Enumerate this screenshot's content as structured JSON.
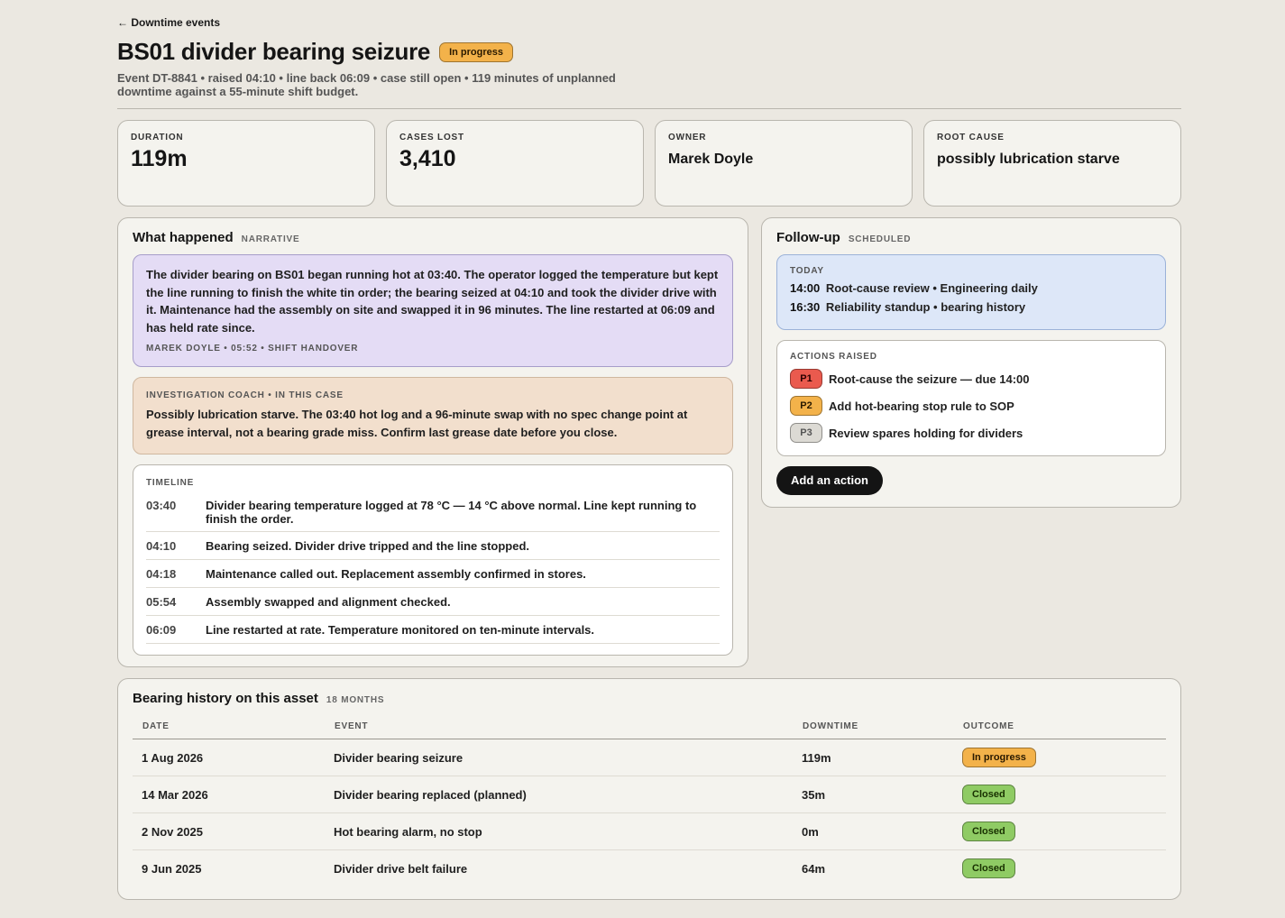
{
  "nav": {
    "back_label": "← Downtime events"
  },
  "header": {
    "title": "BS01 divider bearing seizure",
    "status": "In progress",
    "subtitle": "Event DT-8841 • raised 04:10 • line back 06:09 • case still open • 119 minutes of unplanned downtime against a 55-minute shift budget."
  },
  "stats": [
    {
      "label": "DURATION",
      "value": "119m"
    },
    {
      "label": "CASES LOST",
      "value": "3,410"
    },
    {
      "label": "OWNER",
      "value": "Marek Doyle"
    },
    {
      "label": "ROOT CAUSE",
      "value": "possibly lubrication starve"
    }
  ],
  "what_happened": {
    "title": "What happened",
    "tag": "NARRATIVE",
    "narrative": "The divider bearing on BS01 began running hot at 03:40. The operator logged the temperature but kept the line running to finish the white tin order; the bearing seized at 04:10 and took the divider drive with it. Maintenance had the assembly on site and swapped it in 96 minutes. The line restarted at 06:09 and has held rate since.",
    "narrative_author": "MAREK DOYLE • 05:52 • SHIFT HANDOVER",
    "coach_label": "INVESTIGATION COACH • IN THIS CASE",
    "coach_text": "Possibly lubrication starve. The 03:40 hot log and a 96-minute swap with no spec change point at grease interval, not a bearing grade miss. Confirm last grease date before you close.",
    "timeline_label": "TIMELINE",
    "timeline": [
      {
        "time": "03:40",
        "text": "Divider bearing temperature logged at 78 °C — 14 °C above normal. Line kept running to finish the order."
      },
      {
        "time": "04:10",
        "text": "Bearing seized. Divider drive tripped and the line stopped."
      },
      {
        "time": "04:18",
        "text": "Maintenance called out. Replacement assembly confirmed in stores."
      },
      {
        "time": "05:54",
        "text": "Assembly swapped and alignment checked."
      },
      {
        "time": "06:09",
        "text": "Line restarted at rate. Temperature monitored on ten-minute intervals."
      }
    ]
  },
  "followup": {
    "title": "Follow-up",
    "tag": "SCHEDULED",
    "today_label": "TODAY",
    "today": [
      {
        "time": "14:00",
        "text": "Root-cause review • Engineering daily"
      },
      {
        "time": "16:30",
        "text": "Reliability standup • bearing history"
      }
    ],
    "actions_label": "ACTIONS RAISED",
    "actions": [
      {
        "priority": "P1",
        "text": "Root-cause the seizure — due 14:00"
      },
      {
        "priority": "P2",
        "text": "Add hot-bearing stop rule to SOP"
      },
      {
        "priority": "P3",
        "text": "Review spares holding for dividers"
      }
    ],
    "add_action_label": "Add an action"
  },
  "history": {
    "title": "Bearing history on this asset",
    "tag": "18 MONTHS",
    "columns": [
      "DATE",
      "EVENT",
      "DOWNTIME",
      "OUTCOME"
    ],
    "rows": [
      {
        "date": "1 Aug 2026",
        "event": "Divider bearing seizure",
        "downtime": "119m",
        "outcome": "In progress"
      },
      {
        "date": "14 Mar 2026",
        "event": "Divider bearing replaced (planned)",
        "downtime": "35m",
        "outcome": "Closed"
      },
      {
        "date": "2 Nov 2025",
        "event": "Hot bearing alarm, no stop",
        "downtime": "0m",
        "outcome": "Closed"
      },
      {
        "date": "9 Jun 2025",
        "event": "Divider drive belt failure",
        "downtime": "64m",
        "outcome": "Closed"
      }
    ]
  }
}
